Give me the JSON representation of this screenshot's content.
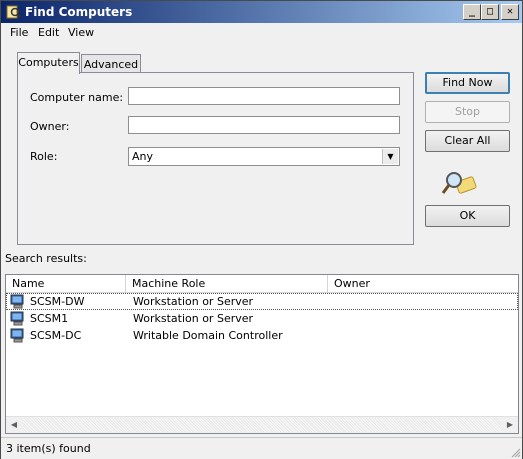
{
  "window": {
    "title": "Find Computers",
    "minimize_glyph": "_",
    "maximize_glyph": "□",
    "close_glyph": "✕"
  },
  "menu": [
    "File",
    "Edit",
    "View"
  ],
  "tabs": [
    {
      "label": "Computers",
      "active": true
    },
    {
      "label": "Advanced",
      "active": false
    }
  ],
  "form": {
    "computer_name_label": "Computer name:",
    "computer_name_value": "",
    "owner_label": "Owner:",
    "owner_value": "",
    "role_label": "Role:",
    "role_value": "Any"
  },
  "buttons": {
    "find_now": "Find Now",
    "stop": "Stop",
    "clear_all": "Clear All",
    "ok": "OK"
  },
  "results": {
    "label": "Search results:",
    "columns": [
      "Name",
      "Machine Role",
      "Owner"
    ],
    "rows": [
      {
        "name": "SCSM-DW",
        "role": "Workstation or Server",
        "owner": ""
      },
      {
        "name": "SCSM1",
        "role": "Workstation or Server",
        "owner": ""
      },
      {
        "name": "SCSM-DC",
        "role": "Writable Domain Controller",
        "owner": ""
      }
    ]
  },
  "status": "3 item(s) found",
  "colors": {
    "title_start": "#0a246a",
    "title_end": "#a6caf0",
    "default_button_border": "#3c7fb1"
  },
  "icons": [
    "find-computers-icon",
    "magnifier-icon",
    "computer-icon",
    "scroll-left-icon",
    "scroll-right-icon",
    "size-grip-icon"
  ]
}
